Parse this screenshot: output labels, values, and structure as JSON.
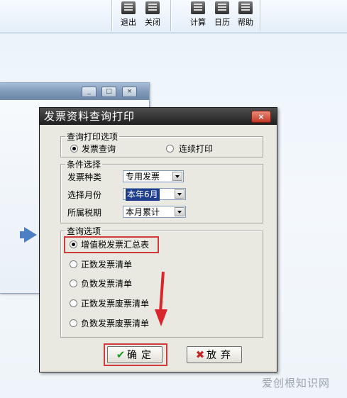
{
  "toolbar": {
    "buttons": [
      {
        "label": "退出",
        "icon": "exit-icon"
      },
      {
        "label": "关闭",
        "icon": "close-doc-icon"
      },
      {
        "label": "计算",
        "icon": "calculator-icon"
      },
      {
        "label": "日历",
        "icon": "calendar-icon"
      },
      {
        "label": "帮助",
        "icon": "help-icon"
      }
    ]
  },
  "background_window": {
    "controls": {
      "minimize": "_",
      "maximize": "□",
      "close": "×"
    }
  },
  "dialog": {
    "title": "发票资料查询打印",
    "close_label": "×",
    "print_options": {
      "legend": "查询打印选项",
      "options": [
        {
          "label": "发票查询",
          "selected": true
        },
        {
          "label": "连续打印",
          "selected": false
        }
      ]
    },
    "conditions": {
      "legend": "条件选择",
      "invoice_type": {
        "label": "发票种类",
        "value": "专用发票"
      },
      "month": {
        "label": "选择月份",
        "value": "本年6月"
      },
      "tax_period": {
        "label": "所属税期",
        "value": "本月累计"
      }
    },
    "query_options": {
      "legend": "查询选项",
      "options": [
        {
          "label": "增值税发票汇总表",
          "selected": true
        },
        {
          "label": "正数发票清单",
          "selected": false
        },
        {
          "label": "负数发票清单",
          "selected": false
        },
        {
          "label": "正数发票废票清单",
          "selected": false
        },
        {
          "label": "负数发票废票清单",
          "selected": false
        }
      ]
    },
    "ok_button": {
      "label": "确定",
      "icon": "checkmark-icon"
    },
    "cancel_button": {
      "label": "放弃",
      "icon": "x-mark-icon"
    }
  },
  "watermark": "爱创根知识网",
  "colors": {
    "highlight_red": "#d23b3b",
    "arrow_red": "#d8262c",
    "selection_blue": "#1e3d8f",
    "titlebar_dark": "#1f1f1f"
  }
}
